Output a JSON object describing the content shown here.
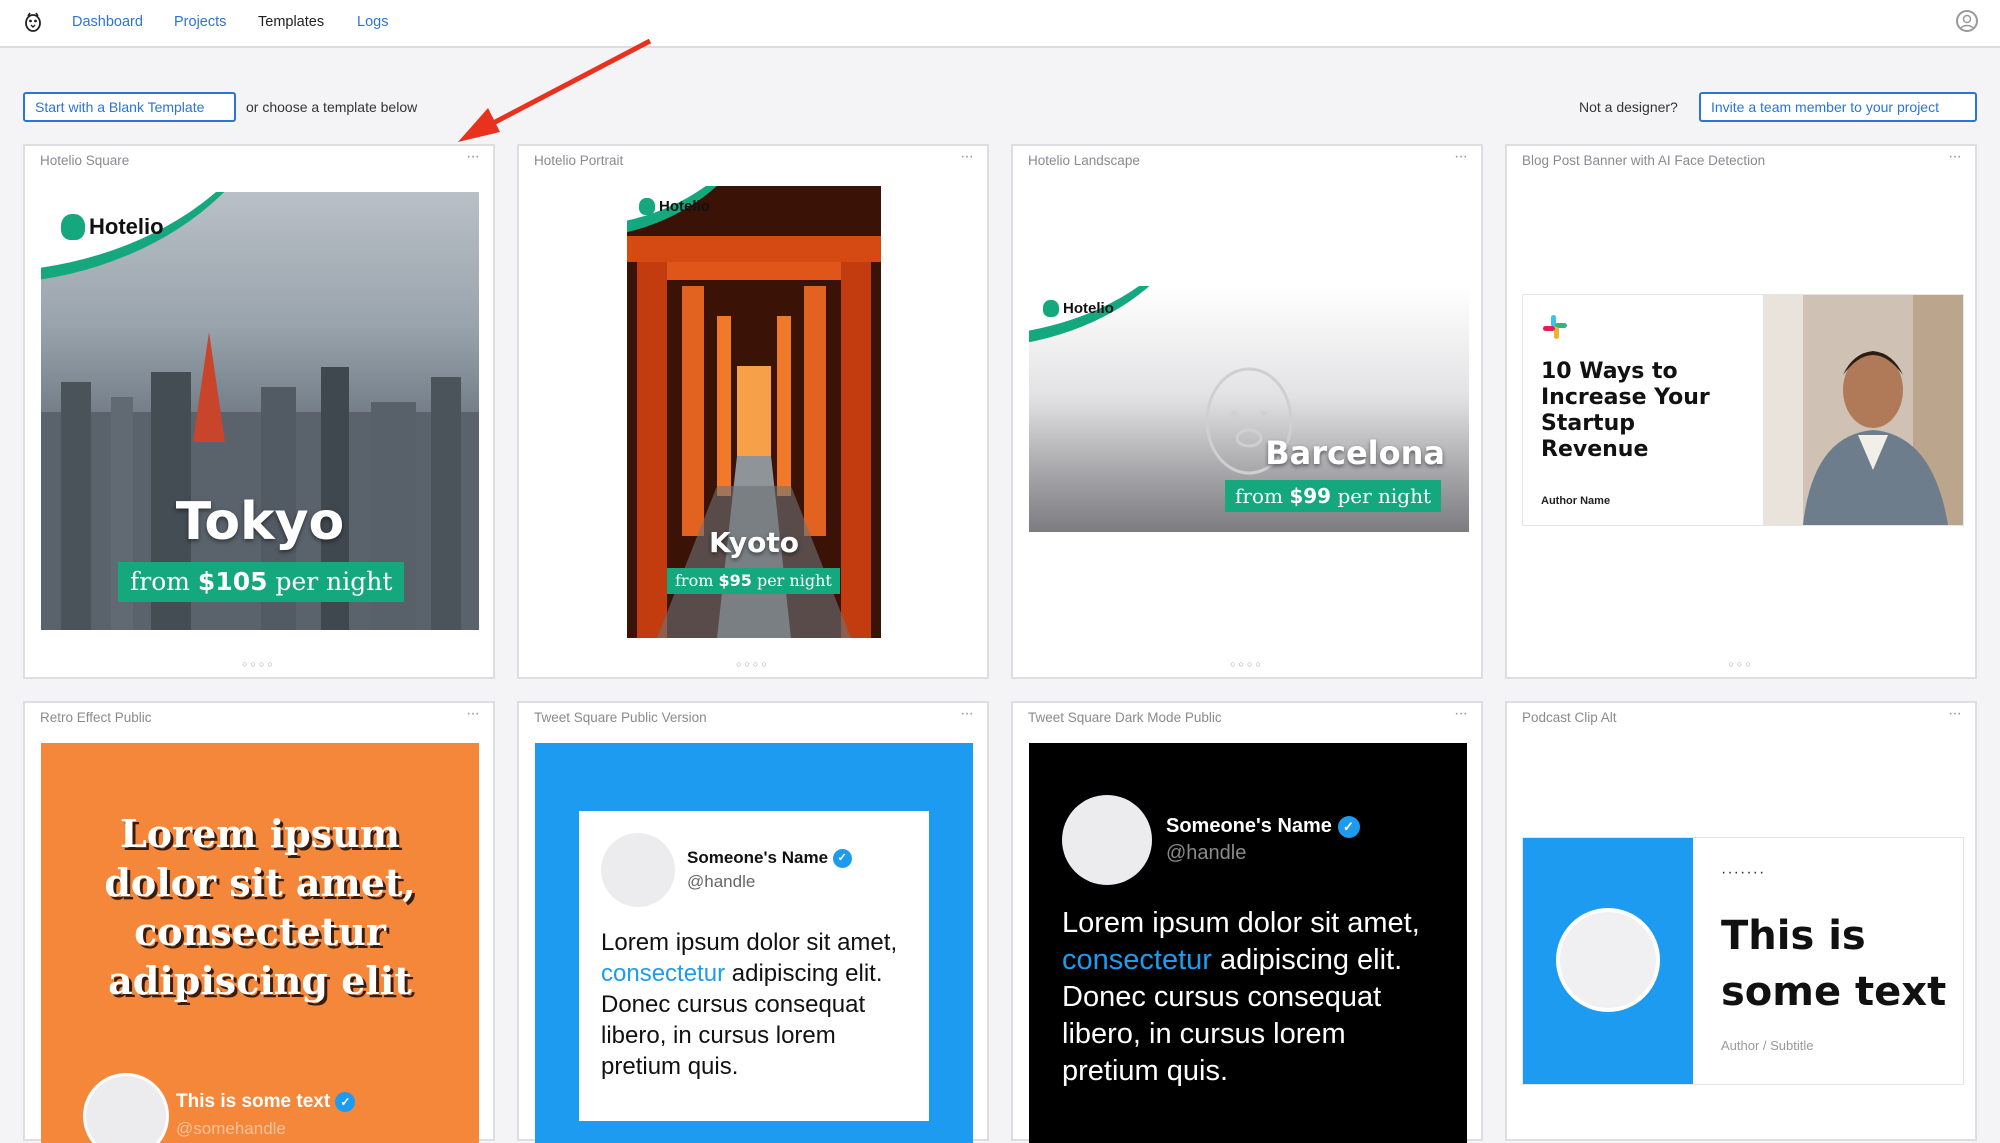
{
  "nav": {
    "items": [
      {
        "label": "Dashboard",
        "active": false
      },
      {
        "label": "Projects",
        "active": false
      },
      {
        "label": "Templates",
        "active": true
      },
      {
        "label": "Logs",
        "active": false
      }
    ]
  },
  "toolbar": {
    "blank_button": "Start with a Blank Template",
    "choose_text": "or choose a template below",
    "not_designer": "Not a designer?",
    "invite_button": "Invite a team member to your project"
  },
  "cards": [
    {
      "title": "Hotelio Square",
      "menu": "···",
      "dots": "○○○○"
    },
    {
      "title": "Hotelio Portrait",
      "menu": "···",
      "dots": "○○○○"
    },
    {
      "title": "Hotelio Landscape",
      "menu": "···",
      "dots": "○○○○"
    },
    {
      "title": "Blog Post Banner with AI Face Detection",
      "menu": "···",
      "dots": "○○○"
    },
    {
      "title": "Retro Effect Public",
      "menu": "···"
    },
    {
      "title": "Tweet Square Public Version",
      "menu": "···"
    },
    {
      "title": "Tweet Square Dark Mode Public",
      "menu": "···"
    },
    {
      "title": "Podcast Clip Alt",
      "menu": "···"
    }
  ],
  "hotelio": {
    "brand": "Hotelio",
    "square": {
      "city": "Tokyo",
      "from": "from",
      "price": "$105",
      "per": "per night"
    },
    "portrait": {
      "city": "Kyoto",
      "from": "from",
      "price": "$95",
      "per": "per night"
    },
    "landscape": {
      "city": "Barcelona",
      "from": "from",
      "price": "$99",
      "per": "per night"
    }
  },
  "blog": {
    "headline": "10 Ways to Increase Your Startup Revenue",
    "author": "Author Name"
  },
  "retro": {
    "headline": "Lorem ipsum dolor sit amet, consectetur adipiscing elit",
    "name": "This is some text",
    "handle": "@somehandle"
  },
  "tweet": {
    "name": "Someone's Name",
    "handle": "@handle",
    "text_before": "Lorem ipsum dolor sit amet, ",
    "link": "consectetur",
    "text_after": " adipiscing elit. Donec cursus consequat libero, in cursus lorem pretium quis."
  },
  "podcast": {
    "dots": "·······",
    "headline": "This is some text",
    "subtitle": "Author / Subtitle"
  },
  "colors": {
    "accent": "#2b74d9",
    "hotelio_green": "#15a77e",
    "twitter_blue": "#1d9bf0",
    "retro_orange": "#f5873a",
    "annotation_arrow": "#e8321e"
  }
}
